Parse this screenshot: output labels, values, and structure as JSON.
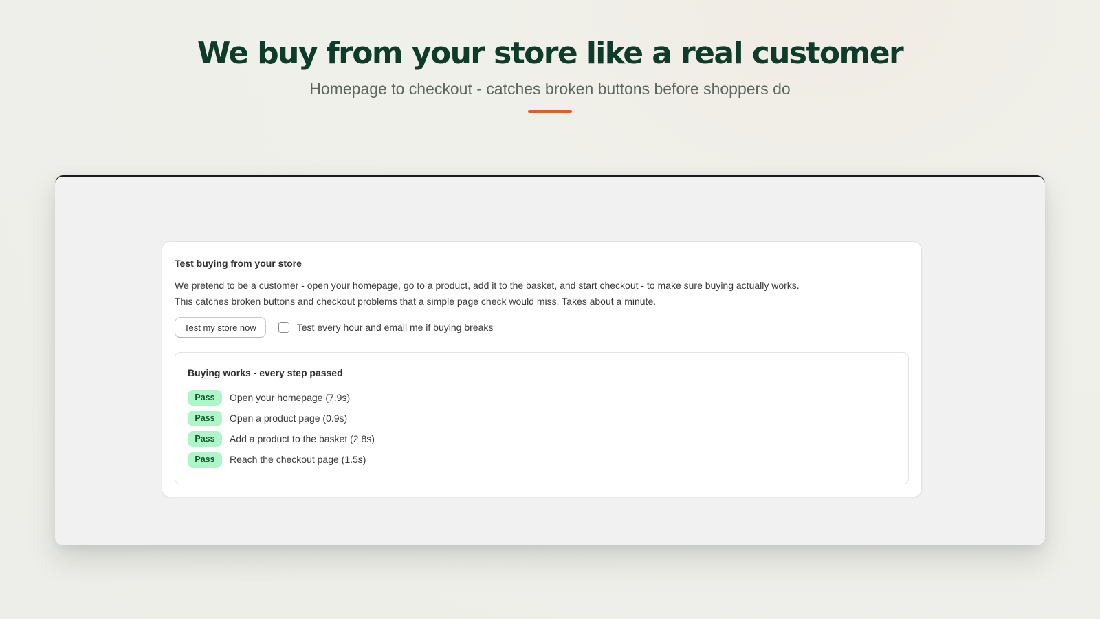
{
  "hero": {
    "title": "We buy from your store like a real customer",
    "subtitle": "Homepage to checkout - catches broken buttons before shoppers do",
    "accent_color": "#d9622b",
    "title_color": "#0f3b2a"
  },
  "card": {
    "title": "Test buying from your store",
    "description_line1": "We pretend to be a customer - open your homepage, go to a product, add it to the basket, and start checkout - to make sure buying actually works.",
    "description_line2": "This catches broken buttons and checkout problems that a simple page check would miss. Takes about a minute.",
    "test_button_label": "Test my store now",
    "schedule_checkbox_label": "Test every hour and email me if buying breaks",
    "schedule_checked": false
  },
  "results": {
    "title": "Buying works - every step passed",
    "badge_color": "#aff5c8",
    "steps": [
      {
        "status": "Pass",
        "label": "Open your homepage (7.9s)"
      },
      {
        "status": "Pass",
        "label": "Open a product page (0.9s)"
      },
      {
        "status": "Pass",
        "label": "Add a product to the basket (2.8s)"
      },
      {
        "status": "Pass",
        "label": "Reach the checkout page (1.5s)"
      }
    ]
  }
}
